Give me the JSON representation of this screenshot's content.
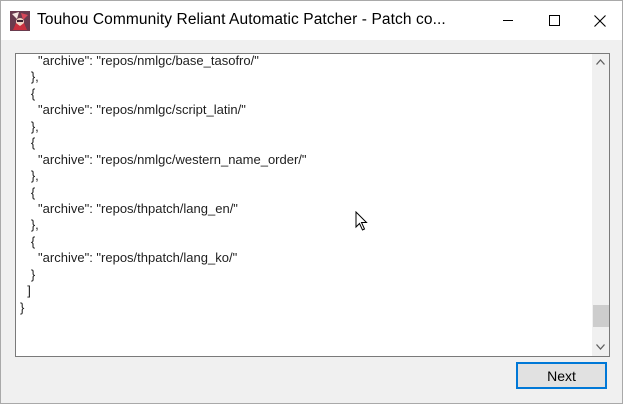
{
  "window": {
    "title": "Touhou Community Reliant Automatic Patcher - Patch co...",
    "controls": [
      "minimize",
      "maximize",
      "close"
    ]
  },
  "editor": {
    "lines": [
      "     \"archive\": \"repos/nmlgc/base_tasofro/\"",
      "   },",
      "   {",
      "     \"archive\": \"repos/nmlgc/script_latin/\"",
      "   },",
      "   {",
      "     \"archive\": \"repos/nmlgc/western_name_order/\"",
      "   },",
      "   {",
      "     \"archive\": \"repos/thpatch/lang_en/\"",
      "   },",
      "   {",
      "     \"archive\": \"repos/thpatch/lang_ko/\"",
      "   }",
      "  ]",
      "}"
    ],
    "scroll_position": 0.95
  },
  "buttons": {
    "next_label": "Next"
  },
  "colors": {
    "focus_border": "#0078d7",
    "button_face": "#e1e1e1",
    "window_bg": "#f0f0f0"
  }
}
